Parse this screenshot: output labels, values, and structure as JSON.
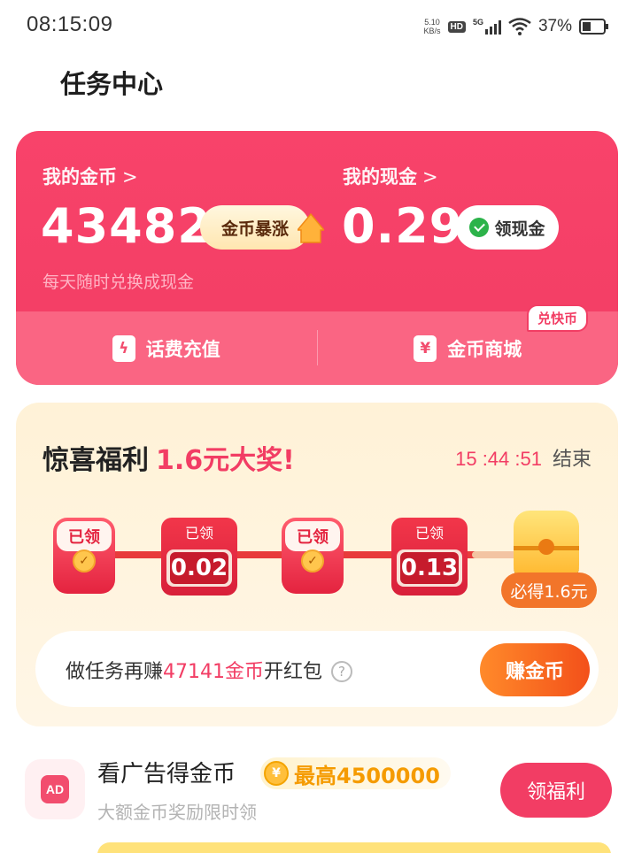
{
  "status_bar": {
    "time": "08:15:09",
    "net_speed_value": "5.10",
    "net_speed_unit": "KB/s",
    "hd_label": "HD",
    "network": "5G",
    "battery_percent": "37%"
  },
  "page": {
    "title": "任务中心"
  },
  "wallet": {
    "coins_label": "我的金币",
    "coins_value": "43482",
    "coins_surge_label": "金币暴涨",
    "cash_label": "我的现金",
    "cash_value": "0.29",
    "withdraw_label": "领现金",
    "exchange_hint": "每天随时兑换成现金",
    "phone_topup_label": "话费充值",
    "coin_mall_label": "金币商城",
    "coin_mall_badge": "兑快币",
    "chevron": ">"
  },
  "bonus": {
    "title": "惊喜福利",
    "highlight": "1.6元大奖!",
    "timer": "15 :44 :51",
    "timer_suffix": "结束",
    "steps": [
      {
        "type": "claimed_envelope",
        "label": "已领"
      },
      {
        "type": "amount",
        "label": "已领",
        "amount": "0.02"
      },
      {
        "type": "claimed_envelope",
        "label": "已领"
      },
      {
        "type": "amount",
        "label": "已领",
        "amount": "0.13"
      },
      {
        "type": "final_gift",
        "label": "必得1.6元"
      }
    ],
    "task_prefix": "做任务再赚",
    "task_amount": "47141金币",
    "task_suffix": "开红包",
    "help_icon": "?",
    "earn_button": "赚金币"
  },
  "ad_task": {
    "icon_text": "AD",
    "title": "看广告得金币",
    "max_reward": "最高4500000",
    "subtitle": "大额金币奖励限时领",
    "button": "领福利"
  },
  "colors": {
    "primary": "#f23d64",
    "accent_orange": "#f3501a",
    "bonus_bg": "#fff2d7"
  }
}
